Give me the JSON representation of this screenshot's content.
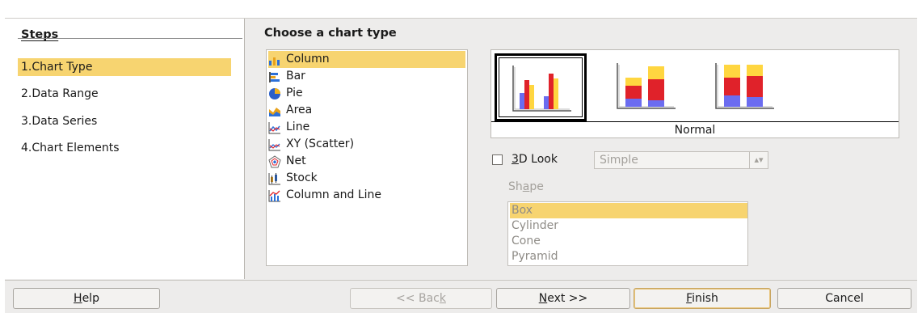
{
  "dialog": {
    "steps": {
      "title": "Steps",
      "items": [
        {
          "label": "1.Chart Type",
          "active": true
        },
        {
          "label": "2.Data Range",
          "active": false
        },
        {
          "label": "3.Data Series",
          "active": false
        },
        {
          "label": "4.Chart Elements",
          "active": false
        }
      ]
    },
    "content": {
      "title": "Choose a chart type",
      "chart_types": [
        {
          "label": "Column",
          "icon": "column-chart-icon",
          "selected": true
        },
        {
          "label": "Bar",
          "icon": "bar-chart-icon",
          "selected": false
        },
        {
          "label": "Pie",
          "icon": "pie-chart-icon",
          "selected": false
        },
        {
          "label": "Area",
          "icon": "area-chart-icon",
          "selected": false
        },
        {
          "label": "Line",
          "icon": "line-chart-icon",
          "selected": false
        },
        {
          "label": "XY (Scatter)",
          "icon": "scatter-chart-icon",
          "selected": false
        },
        {
          "label": "Net",
          "icon": "net-chart-icon",
          "selected": false
        },
        {
          "label": "Stock",
          "icon": "stock-chart-icon",
          "selected": false
        },
        {
          "label": "Column and Line",
          "icon": "column-line-chart-icon",
          "selected": false
        }
      ],
      "variants": [
        {
          "name": "normal-column-variant",
          "selected": true
        },
        {
          "name": "stacked-column-variant",
          "selected": false
        },
        {
          "name": "percent-stacked-column-variant",
          "selected": false
        }
      ],
      "variant_label": "Normal",
      "three_d": {
        "label_prefix": "",
        "label_accel": "3",
        "label_rest": "D Look",
        "checked": false
      },
      "scheme_select": {
        "value": "Simple",
        "enabled": false
      },
      "shape": {
        "label_prefix": "Sh",
        "label_accel": "a",
        "label_rest": "pe",
        "items": [
          {
            "label": "Box",
            "selected": true
          },
          {
            "label": "Cylinder",
            "selected": false
          },
          {
            "label": "Cone",
            "selected": false
          },
          {
            "label": "Pyramid",
            "selected": false
          }
        ]
      }
    },
    "buttons": {
      "help": {
        "accel": "H",
        "rest": "elp"
      },
      "back": {
        "prefix": "<< Bac",
        "accel": "k",
        "rest": "",
        "enabled": false
      },
      "next": {
        "prefix": "",
        "accel": "N",
        "rest": "ext >>"
      },
      "finish": {
        "prefix": "",
        "accel": "F",
        "rest": "inish"
      },
      "cancel": {
        "label": "Cancel"
      }
    },
    "colors": {
      "selection": "#f7d470",
      "bar_red": "#e0222a",
      "bar_yellow": "#ffd640",
      "bar_blue": "#6b6cf0",
      "dialog_bg": "#edeceb"
    }
  }
}
